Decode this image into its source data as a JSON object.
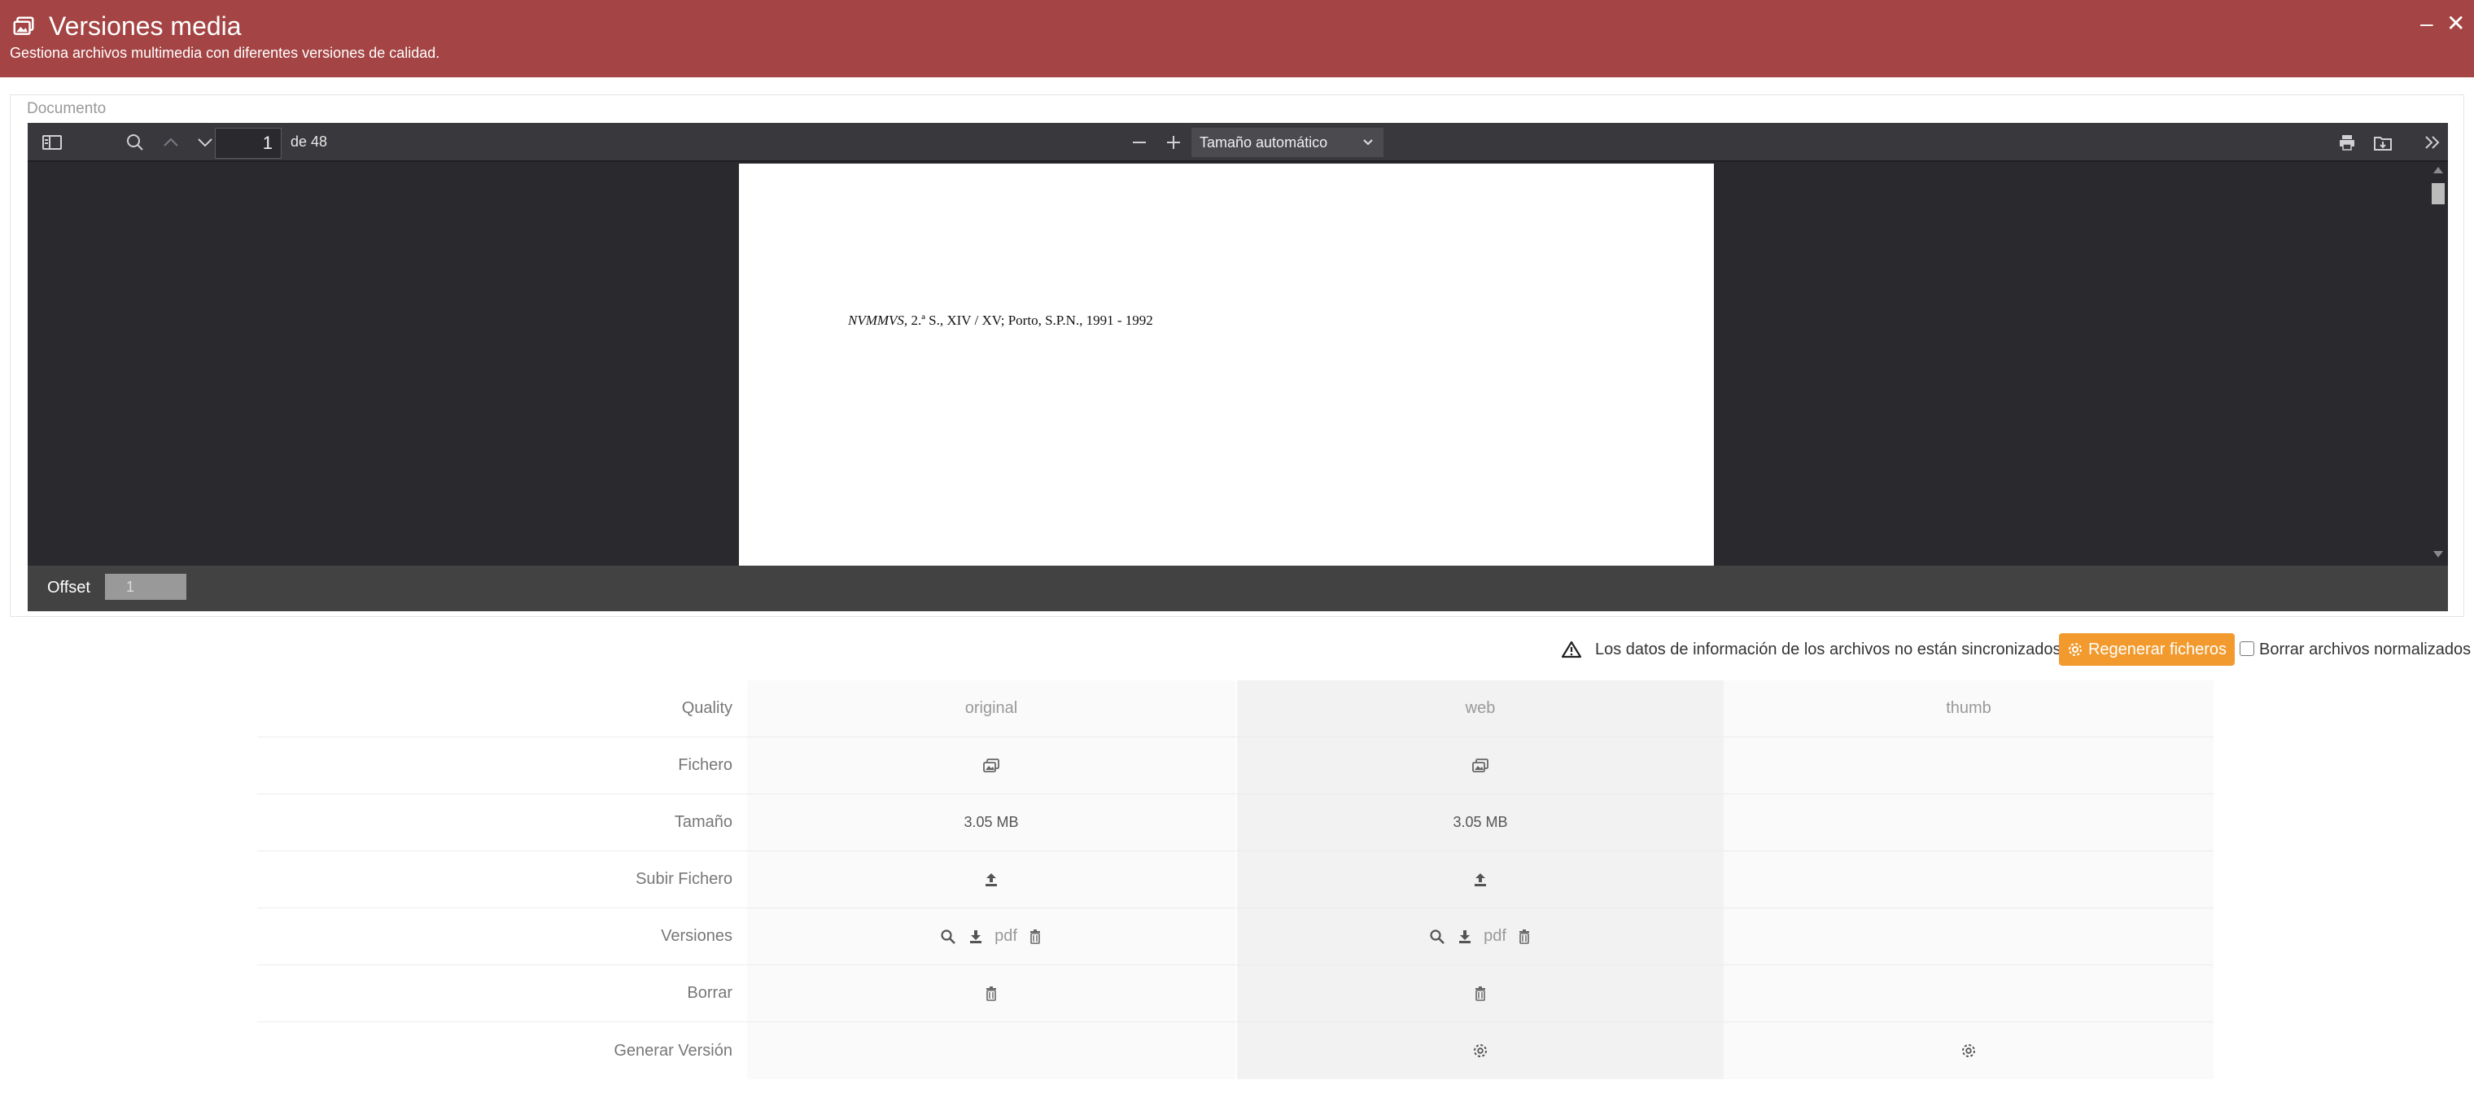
{
  "window": {
    "title": "Versiones media",
    "subtitle": "Gestiona archivos multimedia con diferentes versiones de calidad.",
    "minimize": "–",
    "close": "✕"
  },
  "document": {
    "label": "Documento",
    "viewer": {
      "current_page": "1",
      "page_count_label": "de 48",
      "zoom_label": "Tamaño automático",
      "page_text_italic": "NVMMVS,",
      "page_text": " 2.ª S., XIV / XV; Porto, S.P.N., 1991 - 1992"
    },
    "offset": {
      "label": "Offset",
      "value": "1"
    }
  },
  "sync_warning": {
    "text": "Los datos de información de los archivos no están sincronizados",
    "regen_button": "Regenerar ficheros",
    "checkbox_label": "Borrar archivos normalizados"
  },
  "quality_table": {
    "row_labels": {
      "quality": "Quality",
      "fichero": "Fichero",
      "tamano": "Tamaño",
      "subir": "Subir Fichero",
      "versiones": "Versiones",
      "borrar": "Borrar",
      "generar": "Generar Versión"
    },
    "columns": [
      {
        "name": "original",
        "size": "3.05 MB",
        "version_ext": "pdf"
      },
      {
        "name": "web",
        "size": "3.05 MB",
        "version_ext": "pdf"
      },
      {
        "name": "thumb"
      }
    ]
  },
  "colors": {
    "header_bg": "#a44444",
    "regen_button_bg": "#f29a2e",
    "viewer_bg": "#2a2a2e"
  }
}
